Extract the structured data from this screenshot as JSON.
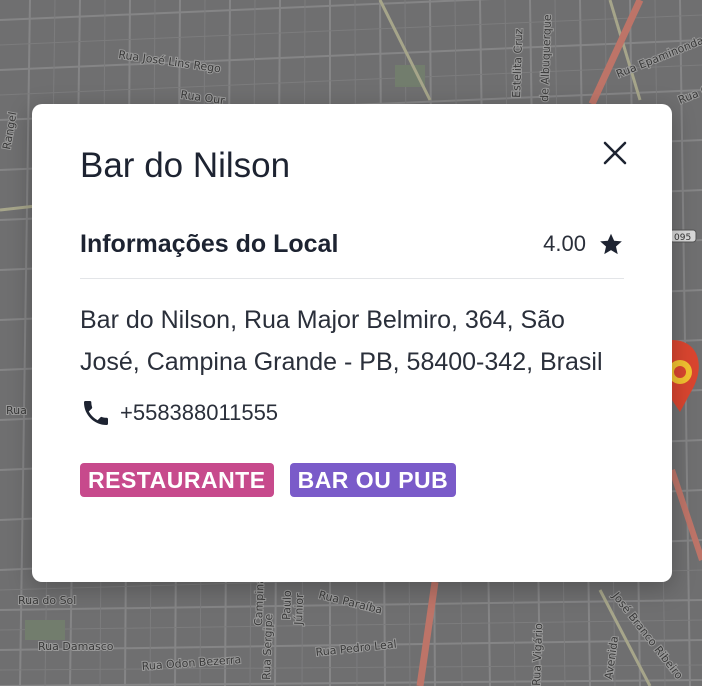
{
  "map": {
    "streets": [
      "Rua José Lins Rego",
      "Rua Our",
      "Estelita Cruz",
      "de Albuquerque",
      "Rua Epaminonda",
      "Rua Cé",
      "Rangel",
      "Rua",
      "Rua do Sol",
      "Rua Damasco",
      "Rua Odon Bezerra",
      "Rua Sergipe",
      "Júnior",
      "Paulo",
      "Campina",
      "Rua Paraíba",
      "Rua Pedro Leal",
      "Rua Vigário",
      "José Branco Ribeiro",
      "Avenida",
      "095"
    ],
    "colors": {
      "background": "#6f6f70",
      "road": "#8b8b8c",
      "major_road": "#bd7468",
      "park": "#6f7d66"
    }
  },
  "place": {
    "name": "Bar do Nilson",
    "section_title": "Informações do Local",
    "rating": "4.00",
    "address": "Bar do Nilson, Rua Major Belmiro, 364, São José, Campina Grande - PB, 58400-342, Brasil",
    "phone": "+558388011555",
    "tags": [
      {
        "label": "RESTAURANTE",
        "color": "#c74a8c"
      },
      {
        "label": "BAR OU PUB",
        "color": "#7a5bc9"
      }
    ]
  },
  "icons": {
    "close": "close-icon",
    "star": "star-icon",
    "phone": "phone-icon",
    "pin": "map-pin-icon"
  }
}
